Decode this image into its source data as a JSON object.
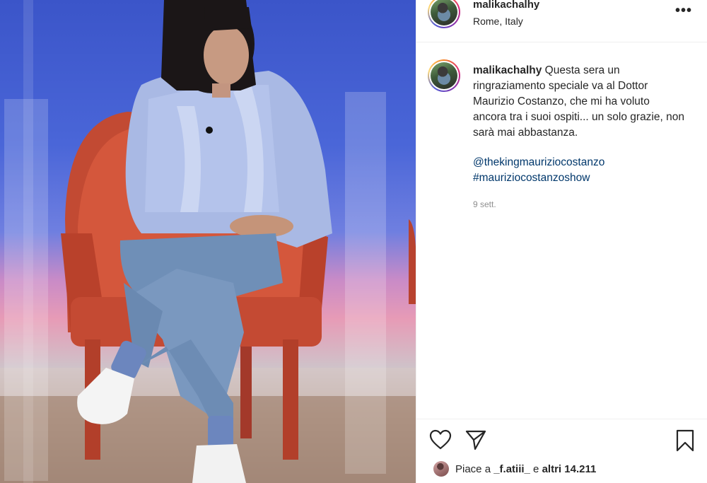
{
  "post": {
    "username": "malikachalhy",
    "location": "Rome, Italy",
    "more_icon": "more-options-icon",
    "caption": {
      "username": "malikachalhy",
      "text": "Questa sera un ringraziamento speciale va al Dottor Maurizio Costanzo, che mi ha voluto ancora tra i suoi ospiti... un solo grazie, non sarà mai abbastanza.",
      "mention": "@thekingmauriziocostanzo",
      "hashtag": "#mauriziocostanzoshow",
      "time": "9 sett."
    },
    "actions": {
      "like_icon": "heart-icon",
      "share_icon": "share-icon",
      "save_icon": "bookmark-icon"
    },
    "likes": {
      "prefix": "Piace a ",
      "first_liker": "_f.atiii_",
      "connector": " e ",
      "others": "altri 14.211"
    }
  },
  "colors": {
    "accent_link": "#00376b",
    "text": "#262626",
    "muted": "#8e8e8e",
    "border": "#efefef"
  }
}
